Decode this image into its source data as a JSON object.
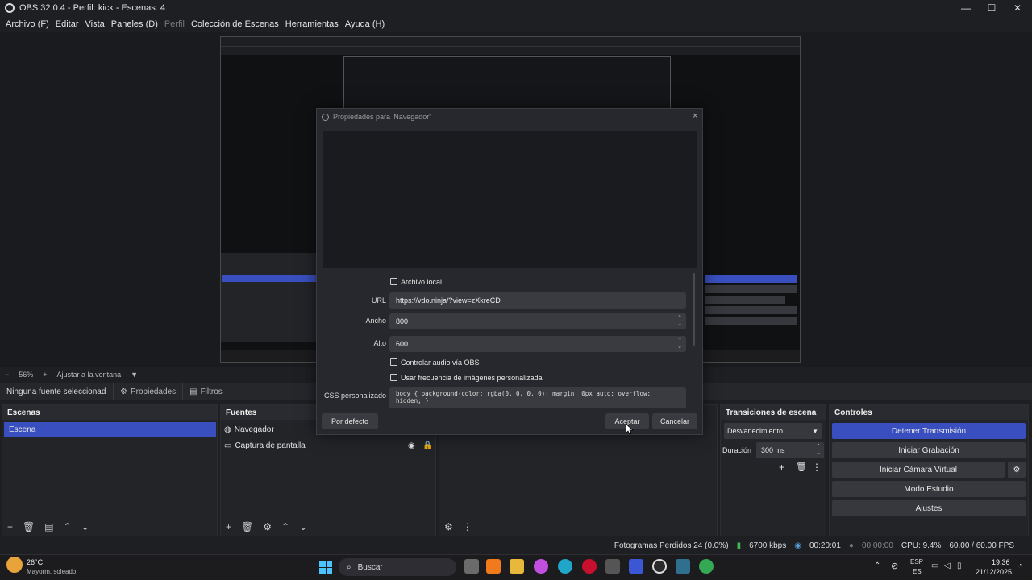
{
  "window": {
    "title": "OBS 32.0.4 - Perfil: kick - Escenas: 4",
    "minimize": "—",
    "maximize": "☐",
    "close": "✕"
  },
  "menu": [
    "Archivo (F)",
    "Editar",
    "Vista",
    "Paneles (D)",
    "Perfil",
    "Colección de Escenas",
    "Herramientas",
    "Ayuda (H)"
  ],
  "preview": {
    "zoom": "56%",
    "fit": "Ajustar a la ventana"
  },
  "source_toolbar": {
    "no_source": "Ninguna fuente seleccionad",
    "properties": "Propiedades",
    "filters": "Filtros"
  },
  "scenes": {
    "title": "Escenas",
    "items": [
      "Escena"
    ]
  },
  "sources": {
    "title": "Fuentes",
    "items": [
      "Navegador",
      "Captura de pantalla"
    ]
  },
  "transitions": {
    "title": "Transiciones de escena",
    "selected": "Desvanecimiento",
    "duration_label": "Duración",
    "duration_value": "300 ms"
  },
  "controls": {
    "title": "Controles",
    "stop_stream": "Detener Transmisión",
    "start_recording": "Iniciar Grabación",
    "start_virtual_cam": "Iniciar Cámara Virtual",
    "studio_mode": "Modo Estudio",
    "settings": "Ajustes"
  },
  "status": {
    "dropped_frames": "Fotogramas Perdidos 24 (0.0%)",
    "bitrate": "6700 kbps",
    "stream_time": "00:20:01",
    "rec_time": "00:00:00",
    "cpu": "CPU: 9.4%",
    "fps": "60.00 / 60.00 FPS"
  },
  "dialog": {
    "title": "Propiedades para 'Navegador'",
    "local_file": "Archivo local",
    "url_label": "URL",
    "url_value": "https://vdo.ninja/?view=zXkreCD",
    "width_label": "Ancho",
    "width_value": "800",
    "height_label": "Alto",
    "height_value": "600",
    "control_audio": "Controlar audio vía OBS",
    "custom_fps": "Usar frecuencia de imágenes personalizada",
    "css_label": "CSS personalizado",
    "css_value": "body { background-color: rgba(0, 0, 0, 0); margin: 0px auto; overflow: hidden; }",
    "defaults": "Por defecto",
    "accept": "Aceptar",
    "cancel": "Cancelar"
  },
  "weather": {
    "temp": "26°C",
    "desc": "Mayorm. soleado"
  },
  "taskbar": {
    "search": "Buscar",
    "lang_top": "ESP",
    "lang_bottom": "ES",
    "time": "19:36",
    "date": "21/12/2025"
  },
  "colors": {
    "accent": "#3a4fbf",
    "bg": "#1e1f22"
  }
}
